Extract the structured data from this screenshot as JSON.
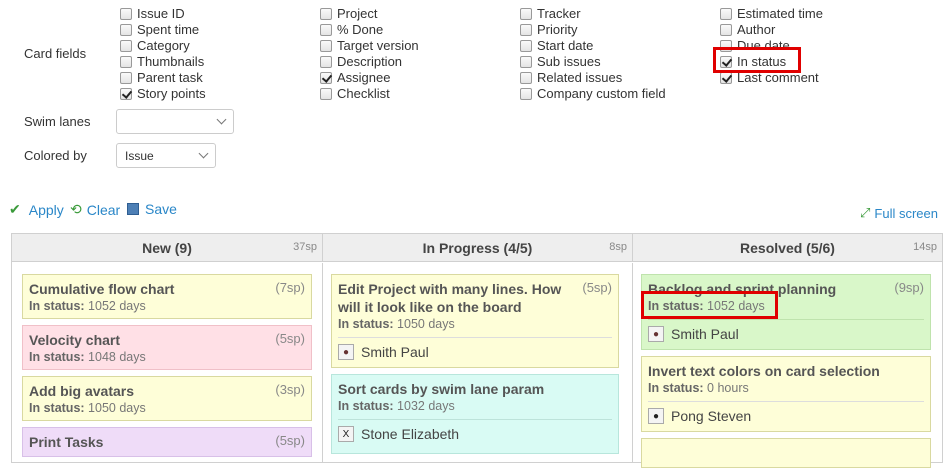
{
  "filters": {
    "card_fields_label": "Card fields",
    "swim_lanes_label": "Swim lanes",
    "colored_by_label": "Colored by",
    "colored_by_value": "Issue",
    "swim_lanes_value": "",
    "fields": [
      [
        {
          "label": "Issue ID",
          "checked": false
        },
        {
          "label": "Spent time",
          "checked": false
        },
        {
          "label": "Category",
          "checked": false
        },
        {
          "label": "Thumbnails",
          "checked": false
        },
        {
          "label": "Parent task",
          "checked": false
        },
        {
          "label": "Story points",
          "checked": true
        }
      ],
      [
        {
          "label": "Project",
          "checked": false
        },
        {
          "label": "% Done",
          "checked": false
        },
        {
          "label": "Target version",
          "checked": false
        },
        {
          "label": "Description",
          "checked": false
        },
        {
          "label": "Assignee",
          "checked": true
        },
        {
          "label": "Checklist",
          "checked": false
        }
      ],
      [
        {
          "label": "Tracker",
          "checked": false
        },
        {
          "label": "Priority",
          "checked": false
        },
        {
          "label": "Start date",
          "checked": false
        },
        {
          "label": "Sub issues",
          "checked": false
        },
        {
          "label": "Related issues",
          "checked": false
        },
        {
          "label": "Company custom field",
          "checked": false
        }
      ],
      [
        {
          "label": "Estimated time",
          "checked": false
        },
        {
          "label": "Author",
          "checked": false
        },
        {
          "label": "Due date",
          "checked": false
        },
        {
          "label": "In status",
          "checked": true
        },
        {
          "label": "Last comment",
          "checked": true
        }
      ]
    ]
  },
  "actions": {
    "apply": "Apply",
    "clear": "Clear",
    "save": "Save",
    "full_screen": "Full screen"
  },
  "board": {
    "columns": [
      {
        "title": "New (9)",
        "sp": "37sp",
        "cards": [
          {
            "title": "Cumulative flow chart",
            "sp": "(7sp)",
            "status_label": "In status:",
            "status_value": "1052 days",
            "color": "yellow"
          },
          {
            "title": "Velocity chart",
            "sp": "(5sp)",
            "status_label": "In status:",
            "status_value": "1048 days",
            "color": "pink"
          },
          {
            "title": "Add big avatars",
            "sp": "(3sp)",
            "status_label": "In status:",
            "status_value": "1050 days",
            "color": "yellow"
          },
          {
            "title": "Print Tasks",
            "sp": "(5sp)",
            "status_label": "",
            "status_value": "",
            "color": "purple"
          }
        ]
      },
      {
        "title": "In Progress (4/5)",
        "sp": "8sp",
        "cards": [
          {
            "title": "Edit Project with many lines. How will it look like on the board",
            "sp": "(5sp)",
            "status_label": "In status:",
            "status_value": "1050 days",
            "assignee": "Smith Paul",
            "color": "yellow"
          },
          {
            "title": "Sort cards by swim lane param",
            "sp": "",
            "status_label": "In status:",
            "status_value": "1032 days",
            "assignee": "Stone Elizabeth",
            "color": "cyan"
          }
        ]
      },
      {
        "title": "Resolved (5/6)",
        "sp": "14sp",
        "cards": [
          {
            "title": "Backlog and sprint planning",
            "sp": "(9sp)",
            "status_label": "In status:",
            "status_value": "1052 days",
            "assignee": "Smith Paul",
            "color": "green"
          },
          {
            "title": "Invert text colors on card selection",
            "sp": "",
            "status_label": "In status:",
            "status_value": "0 hours",
            "assignee": "Pong Steven",
            "color": "yellow"
          }
        ]
      }
    ]
  },
  "colors": {
    "link": "#2a87c8",
    "highlight": "#e00000",
    "apply_check": "#3a9a3a"
  }
}
